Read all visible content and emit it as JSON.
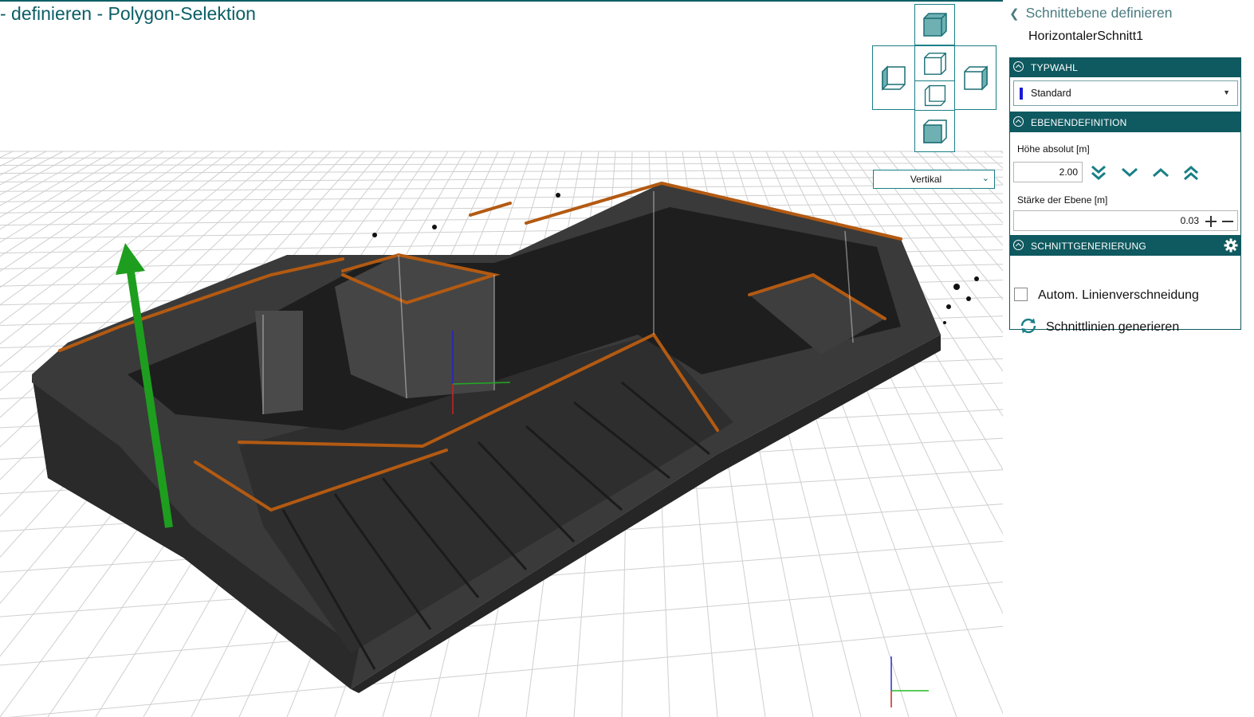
{
  "header": {
    "title": "- definieren - Polygon-Selektion"
  },
  "viewport": {
    "viewcube": {
      "top": "top-view-icon",
      "left": "left-view-icon",
      "front": "front-view-icon",
      "back": "back-view-icon",
      "right": "right-view-icon",
      "bottom": "bottom-view-icon"
    },
    "view_mode": {
      "value": "Vertikal"
    },
    "colors": {
      "accent": "#0b5e66",
      "grid": "#cfcfcf",
      "arrow": "#1e9e1e",
      "edge": "#b35a12"
    }
  },
  "panel": {
    "back_label": "Schnittebene definieren",
    "cut_name": "HorizontalerSchnitt1",
    "sections": {
      "typwahl": {
        "header": "TYPWAHL",
        "type_value": "Standard",
        "swatch_color": "#1a1ad6"
      },
      "ebenendefinition": {
        "header": "EBENENDEFINITION",
        "height_label": "Höhe absolut [m]",
        "height_value": "2.00",
        "thickness_label": "Stärke der Ebene [m]",
        "thickness_value": "0.03"
      },
      "schnittgenerierung": {
        "header": "SCHNITTGENERIERUNG",
        "auto_label": "Autom. Linienverschneidung",
        "auto_checked": false,
        "generate_label": "Schnittlinien generieren"
      }
    }
  }
}
